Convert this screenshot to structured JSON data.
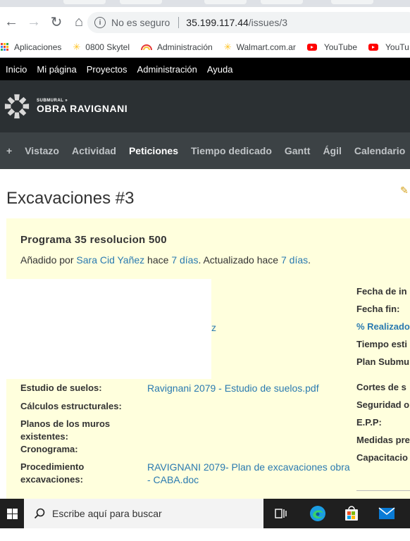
{
  "browser": {
    "security_label": "No es seguro",
    "url_host": "35.199.117.44",
    "url_path": "/issues/3",
    "bookmarks": [
      {
        "label": "Aplicaciones",
        "icon": "apps-grid-icon"
      },
      {
        "label": "0800 Skytel",
        "icon": "walmart-spark-icon"
      },
      {
        "label": "Administración",
        "icon": "rainbow-icon"
      },
      {
        "label": "Walmart.com.ar",
        "icon": "walmart-spark-icon"
      },
      {
        "label": "YouTube",
        "icon": "youtube-icon"
      },
      {
        "label": "YouTu",
        "icon": "youtube-icon"
      }
    ]
  },
  "top_menu": [
    "Inicio",
    "Mi página",
    "Proyectos",
    "Administración",
    "Ayuda"
  ],
  "project": {
    "parent": "SUBMURAL »",
    "name": "OBRA RAVIGNANI"
  },
  "main_menu": {
    "plus": "+",
    "items": [
      "Vistazo",
      "Actividad",
      "Peticiones",
      "Tiempo dedicado",
      "Gantt",
      "Ágil",
      "Calendario"
    ],
    "active": "Peticiones"
  },
  "issue": {
    "title": "Excavaciones #3",
    "subject": "Programa 35 resolucion 500",
    "added_by_prefix": "Añadido por ",
    "author": "Sara Cid Yañez",
    "hace1": " hace ",
    "added_ago": "7 días",
    "updated_text": ". Actualizado hace ",
    "updated_ago": "7 días",
    "end": ".",
    "fragment_z": "z",
    "right_labels": [
      "Fecha de in",
      "Fecha fin:",
      "% Realizado",
      "Tiempo esti",
      "Plan Submu",
      "Cortes de s",
      "Seguridad o",
      "E.P.P:",
      "Medidas pre",
      "Capacitacio"
    ],
    "fields": [
      {
        "label": "Estudio de suelos:",
        "value": "Ravignani 2079 - Estudio de suelos.pdf"
      },
      {
        "label": "Cálculos estructurales:",
        "value": ""
      },
      {
        "label": "Planos de los muros existentes:",
        "value": ""
      },
      {
        "label": "Cronograma:",
        "value": ""
      },
      {
        "label": "Procedimiento excavaciones:",
        "value": "RAVIGNANI 2079- Plan de excavaciones obra - CABA.doc"
      }
    ]
  },
  "taskbar": {
    "search_placeholder": "Escribe aquí para buscar"
  }
}
